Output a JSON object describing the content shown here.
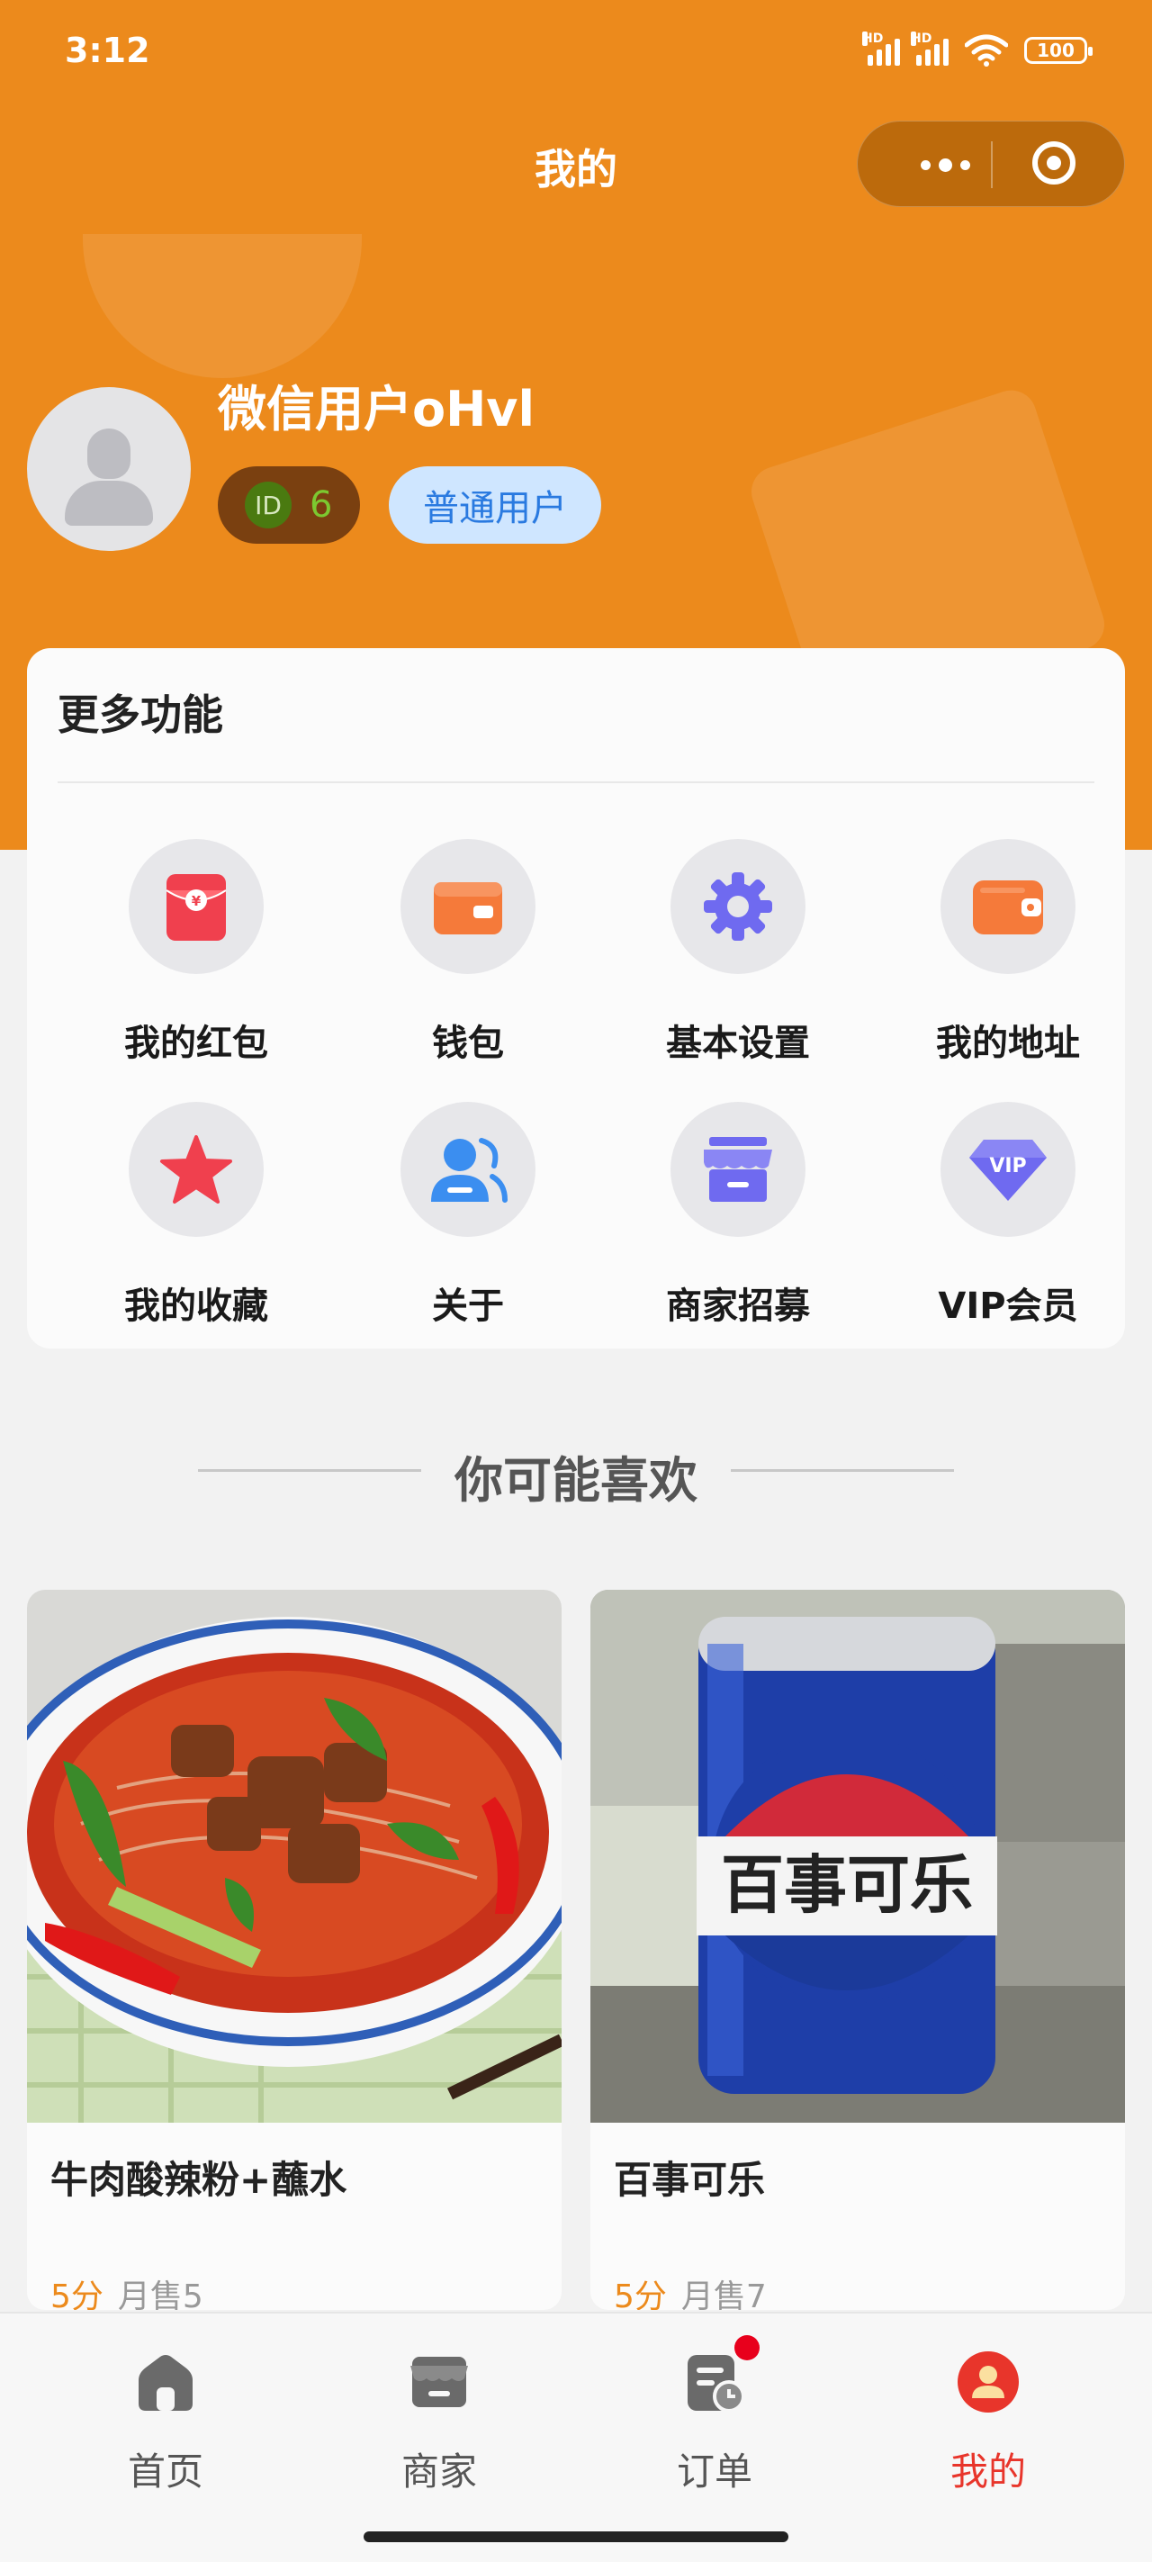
{
  "status_bar": {
    "time": "3:12",
    "hd1": "HD",
    "hd2": "HD",
    "battery": "100"
  },
  "nav": {
    "title": "我的"
  },
  "user": {
    "name": "微信用户oHvl",
    "id_label": "ID",
    "id_value": "6",
    "role": "普通用户"
  },
  "features": {
    "title": "更多功能",
    "items": [
      {
        "label": "我的红包",
        "icon": "red-packet-icon",
        "color": "#f0404e"
      },
      {
        "label": "钱包",
        "icon": "wallet-icon",
        "color": "#f57a3a"
      },
      {
        "label": "基本设置",
        "icon": "gear-icon",
        "color": "#6f6af0"
      },
      {
        "label": "我的地址",
        "icon": "address-wallet-icon",
        "color": "#f57a3a"
      },
      {
        "label": "我的收藏",
        "icon": "star-icon",
        "color": "#f0404e"
      },
      {
        "label": "关于",
        "icon": "users-icon",
        "color": "#3b8ef0"
      },
      {
        "label": "商家招募",
        "icon": "store-icon",
        "color": "#6f6af0"
      },
      {
        "label": "VIP会员",
        "icon": "vip-diamond-icon",
        "color": "#6f6af0"
      }
    ]
  },
  "recommend": {
    "title": "你可能喜欢",
    "products": [
      {
        "name": "牛肉酸辣粉+蘸水",
        "score": "5分",
        "sales": "月售5"
      },
      {
        "name": "百事可乐",
        "score": "5分",
        "sales": "月售7",
        "can_text": "百事可乐"
      }
    ]
  },
  "tabbar": {
    "items": [
      {
        "label": "首页",
        "icon": "home-icon"
      },
      {
        "label": "商家",
        "icon": "store-icon"
      },
      {
        "label": "订单",
        "icon": "order-icon"
      },
      {
        "label": "我的",
        "icon": "user-icon",
        "active": true
      }
    ]
  },
  "colors": {
    "brand": "#ec8a1c",
    "active_tab": "#e8352b",
    "badge_dot": "#e8001c"
  }
}
